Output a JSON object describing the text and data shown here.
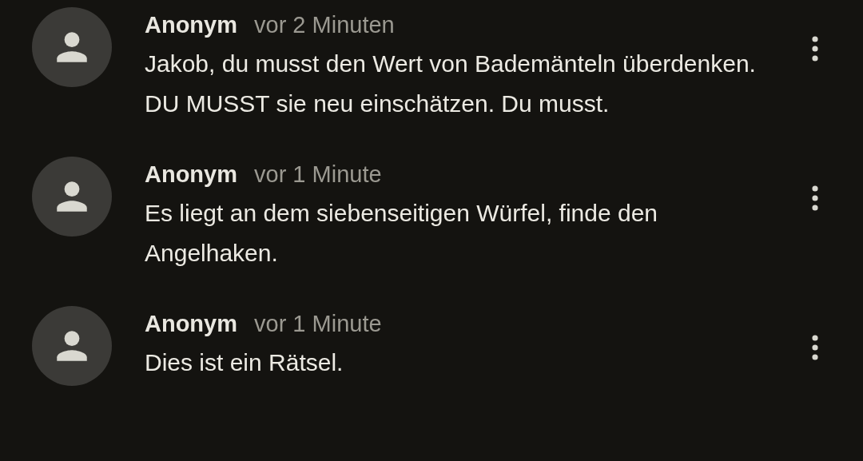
{
  "comments": [
    {
      "author": "Anonym",
      "time": "vor 2 Minuten",
      "text": "Jakob, du musst den Wert von Bademänteln überdenken. DU MUSST sie neu einschätzen. Du musst."
    },
    {
      "author": "Anonym",
      "time": "vor 1 Minute",
      "text": "Es liegt an dem siebenseitigen Würfel, finde den Angelhaken."
    },
    {
      "author": "Anonym",
      "time": "vor 1 Minute",
      "text": "Dies ist ein Rätsel."
    }
  ]
}
